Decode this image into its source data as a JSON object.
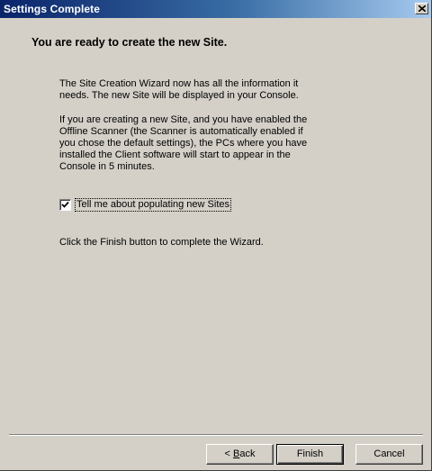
{
  "window": {
    "title": "Settings Complete"
  },
  "content": {
    "heading": "You are ready to create the new Site.",
    "paragraph1": "The Site Creation Wizard now has all the information it needs. The new Site will be displayed in your Console.",
    "paragraph2": "If you are creating a new Site, and you have enabled the Offline Scanner (the Scanner is automatically enabled if you chose the default settings), the PCs where you have installed the Client software will start to appear in the Console in 5 minutes.",
    "checkbox": {
      "label": "Tell me about populating new Sites",
      "checked": true
    },
    "paragraph3": "Click the Finish button to complete the Wizard."
  },
  "buttons": {
    "back_prefix": "< ",
    "back_mnemonic": "B",
    "back_rest": "ack",
    "finish": "Finish",
    "cancel": "Cancel"
  },
  "colors": {
    "titlebar_start": "#0a246a",
    "titlebar_end": "#a6caf0",
    "face": "#d4d0c8"
  },
  "icons": {
    "close": "close-icon",
    "check": "checkmark-icon"
  }
}
